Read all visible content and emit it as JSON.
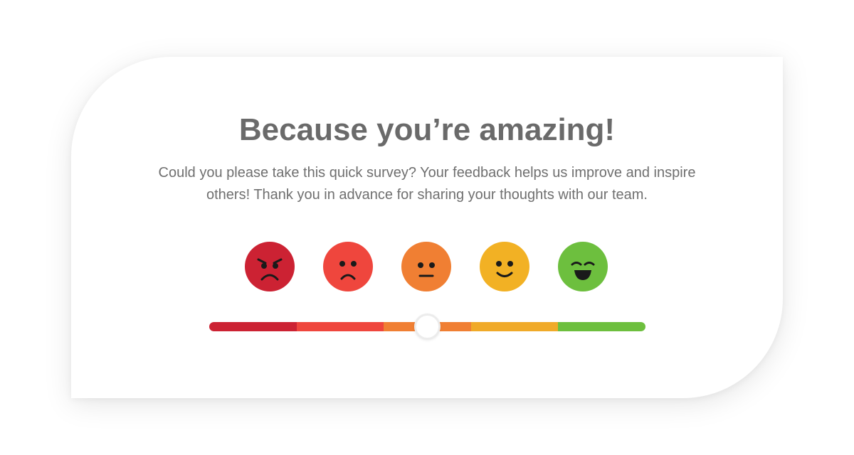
{
  "card": {
    "title": "Because you’re amazing!",
    "description": "Could you please take this quick survey? Your feedback helps us improve and inspire others! Thank you in advance for sharing your thoughts with our team."
  },
  "rating": {
    "faces": [
      {
        "mood": "angry",
        "icon": "angry-face-icon",
        "color": "#cc2233"
      },
      {
        "mood": "sad",
        "icon": "sad-face-icon",
        "color": "#ef463d"
      },
      {
        "mood": "neutral",
        "icon": "neutral-face-icon",
        "color": "#f07f33"
      },
      {
        "mood": "happy",
        "icon": "happy-face-icon",
        "color": "#f2b124"
      },
      {
        "mood": "very-happy",
        "icon": "grinning-face-icon",
        "color": "#6dbf3e"
      }
    ],
    "slider_segments": [
      "#cc2233",
      "#ef463d",
      "#f07f33",
      "#f0aa29",
      "#6dbf3e"
    ],
    "slider_value": 0.5,
    "selected_level": 3,
    "level_count": 5
  }
}
